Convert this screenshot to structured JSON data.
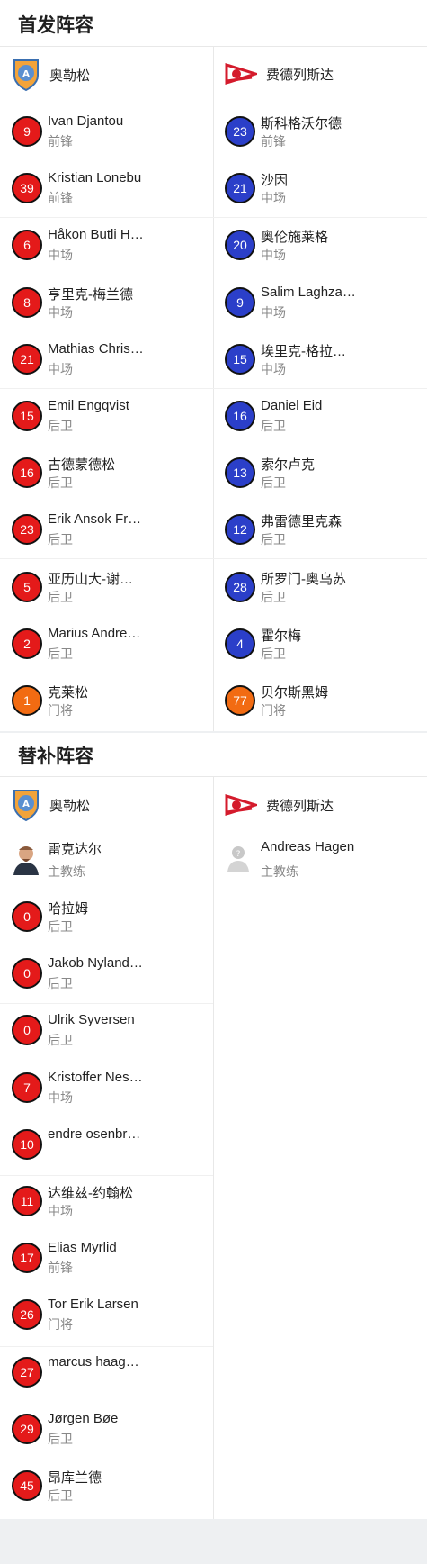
{
  "colors": {
    "home_badge": "#e41a1a",
    "away_badge": "#2b3fc9",
    "gk_badge": "#f26b12"
  },
  "starting": {
    "title": "首发阵容",
    "home_team": "奥勒松",
    "away_team": "费德列斯达",
    "home_players": [
      {
        "num": "9",
        "name": "Ivan Djantou",
        "pos": "前锋",
        "gk": false
      },
      {
        "num": "39",
        "name": "Kristian Lonebu",
        "pos": "前锋",
        "gk": false
      },
      {
        "num": "6",
        "name": "Håkon Butli H…",
        "pos": "中场",
        "gk": false
      },
      {
        "num": "8",
        "name": "亨里克-梅兰德",
        "pos": "中场",
        "gk": false
      },
      {
        "num": "21",
        "name": "Mathias Chris…",
        "pos": "中场",
        "gk": false
      },
      {
        "num": "15",
        "name": "Emil Engqvist",
        "pos": "后卫",
        "gk": false
      },
      {
        "num": "16",
        "name": "古德蒙德松",
        "pos": "后卫",
        "gk": false
      },
      {
        "num": "23",
        "name": "Erik Ansok Fr…",
        "pos": "后卫",
        "gk": false
      },
      {
        "num": "5",
        "name": "亚历山大-谢…",
        "pos": "后卫",
        "gk": false
      },
      {
        "num": "2",
        "name": "Marius Andre…",
        "pos": "后卫",
        "gk": false
      },
      {
        "num": "1",
        "name": "克莱松",
        "pos": "门将",
        "gk": true
      }
    ],
    "away_players": [
      {
        "num": "23",
        "name": "斯科格沃尔德",
        "pos": "前锋",
        "gk": false
      },
      {
        "num": "21",
        "name": "沙因",
        "pos": "中场",
        "gk": false
      },
      {
        "num": "20",
        "name": "奥伦施莱格",
        "pos": "中场",
        "gk": false
      },
      {
        "num": "9",
        "name": "Salim Laghza…",
        "pos": "中场",
        "gk": false
      },
      {
        "num": "15",
        "name": "埃里克-格拉…",
        "pos": "中场",
        "gk": false
      },
      {
        "num": "16",
        "name": "Daniel Eid",
        "pos": "后卫",
        "gk": false
      },
      {
        "num": "13",
        "name": "索尔卢克",
        "pos": "后卫",
        "gk": false
      },
      {
        "num": "12",
        "name": "弗雷德里克森",
        "pos": "后卫",
        "gk": false
      },
      {
        "num": "28",
        "name": "所罗门-奥乌苏",
        "pos": "后卫",
        "gk": false
      },
      {
        "num": "4",
        "name": "霍尔梅",
        "pos": "后卫",
        "gk": false
      },
      {
        "num": "77",
        "name": "贝尔斯黑姆",
        "pos": "门将",
        "gk": true
      }
    ]
  },
  "subs": {
    "title": "替补阵容",
    "home_team": "奥勒松",
    "away_team": "费德列斯达",
    "home_coach": {
      "name": "雷克达尔",
      "role": "主教练"
    },
    "away_coach": {
      "name": "Andreas Hagen",
      "role": "主教练"
    },
    "home_players": [
      {
        "num": "0",
        "name": "哈拉姆",
        "pos": "后卫",
        "gk": false
      },
      {
        "num": "0",
        "name": "Jakob Nyland…",
        "pos": "后卫",
        "gk": false
      },
      {
        "num": "0",
        "name": "Ulrik Syversen",
        "pos": "后卫",
        "gk": false
      },
      {
        "num": "7",
        "name": "Kristoffer Nes…",
        "pos": "中场",
        "gk": false
      },
      {
        "num": "10",
        "name": "endre osenbr…",
        "pos": "",
        "gk": false
      },
      {
        "num": "11",
        "name": "达维兹-约翰松",
        "pos": "中场",
        "gk": false
      },
      {
        "num": "17",
        "name": "Elias Myrlid",
        "pos": "前锋",
        "gk": false
      },
      {
        "num": "26",
        "name": "Tor Erik Larsen",
        "pos": "门将",
        "gk": false
      },
      {
        "num": "27",
        "name": "marcus haag…",
        "pos": "",
        "gk": false
      },
      {
        "num": "29",
        "name": "Jørgen Bøe",
        "pos": "后卫",
        "gk": false
      },
      {
        "num": "45",
        "name": "昂库兰德",
        "pos": "后卫",
        "gk": false
      }
    ]
  }
}
